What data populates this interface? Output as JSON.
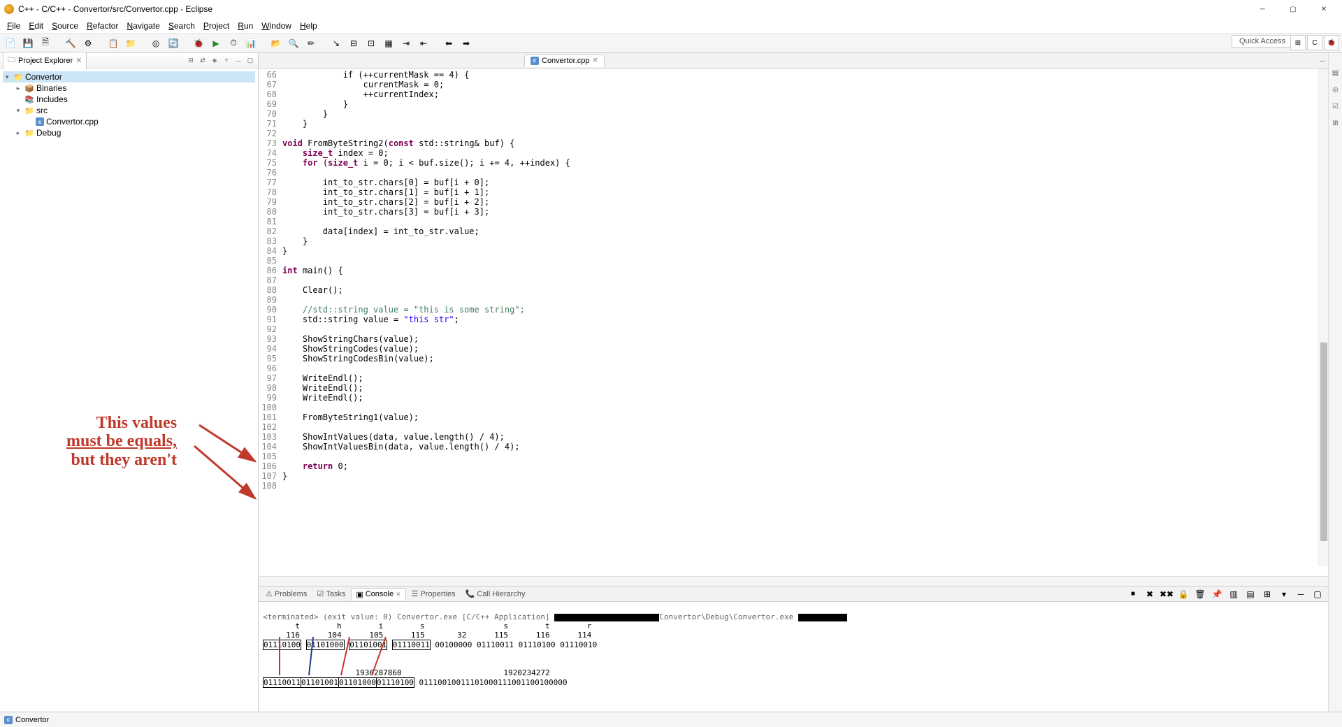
{
  "title": "C++ - C/C++ - Convertor/src/Convertor.cpp - Eclipse",
  "menu": [
    "File",
    "Edit",
    "Source",
    "Refactor",
    "Navigate",
    "Search",
    "Project",
    "Run",
    "Window",
    "Help"
  ],
  "quick_access": "Quick Access",
  "project_explorer": {
    "title": "Project Explorer",
    "root": "Convertor",
    "items": [
      {
        "label": "Binaries",
        "indent": 1,
        "exp": "▸",
        "icon": "📦"
      },
      {
        "label": "Includes",
        "indent": 1,
        "exp": "",
        "icon": "📚"
      },
      {
        "label": "src",
        "indent": 1,
        "exp": "▾",
        "icon": "📁"
      },
      {
        "label": "Convertor.cpp",
        "indent": 2,
        "exp": "",
        "icon": "c"
      },
      {
        "label": "Debug",
        "indent": 1,
        "exp": "▸",
        "icon": "📁"
      }
    ]
  },
  "editor_tab": "Convertor.cpp",
  "code_lines": [
    {
      "n": 66,
      "t": "            if (++currentMask == 4) {"
    },
    {
      "n": 67,
      "t": "                currentMask = 0;"
    },
    {
      "n": 68,
      "t": "                ++currentIndex;"
    },
    {
      "n": 69,
      "t": "            }"
    },
    {
      "n": 70,
      "t": "        }"
    },
    {
      "n": 71,
      "t": "    }"
    },
    {
      "n": 72,
      "t": ""
    },
    {
      "n": 73,
      "t": "void FromByteString2(const std::string& buf) {",
      "hl": "void |const "
    },
    {
      "n": 74,
      "t": "    size_t index = 0;"
    },
    {
      "n": 75,
      "t": "    for (size_t i = 0; i < buf.size(); i += 4, ++index) {",
      "hl": "for "
    },
    {
      "n": 76,
      "t": ""
    },
    {
      "n": 77,
      "t": "        int_to_str.chars[0] = buf[i + 0];"
    },
    {
      "n": 78,
      "t": "        int_to_str.chars[1] = buf[i + 1];"
    },
    {
      "n": 79,
      "t": "        int_to_str.chars[2] = buf[i + 2];"
    },
    {
      "n": 80,
      "t": "        int_to_str.chars[3] = buf[i + 3];"
    },
    {
      "n": 81,
      "t": ""
    },
    {
      "n": 82,
      "t": "        data[index] = int_to_str.value;"
    },
    {
      "n": 83,
      "t": "    }"
    },
    {
      "n": 84,
      "t": "}"
    },
    {
      "n": 85,
      "t": ""
    },
    {
      "n": 86,
      "t": "int main() {",
      "hl": "int "
    },
    {
      "n": 87,
      "t": ""
    },
    {
      "n": 88,
      "t": "    Clear();"
    },
    {
      "n": 89,
      "t": ""
    },
    {
      "n": 90,
      "t": "    //std::string value = \"this is some string\";",
      "cmt": true
    },
    {
      "n": 91,
      "t": "    std::string value = \"this str\";",
      "str": "\"this str\""
    },
    {
      "n": 92,
      "t": ""
    },
    {
      "n": 93,
      "t": "    ShowStringChars(value);"
    },
    {
      "n": 94,
      "t": "    ShowStringCodes(value);"
    },
    {
      "n": 95,
      "t": "    ShowStringCodesBin(value);"
    },
    {
      "n": 96,
      "t": ""
    },
    {
      "n": 97,
      "t": "    WriteEndl();"
    },
    {
      "n": 98,
      "t": "    WriteEndl();"
    },
    {
      "n": 99,
      "t": "    WriteEndl();"
    },
    {
      "n": 100,
      "t": ""
    },
    {
      "n": 101,
      "t": "    FromByteString1(value);"
    },
    {
      "n": 102,
      "t": ""
    },
    {
      "n": 103,
      "t": "    ShowIntValues(data, value.length() / 4);"
    },
    {
      "n": 104,
      "t": "    ShowIntValuesBin(data, value.length() / 4);"
    },
    {
      "n": 105,
      "t": ""
    },
    {
      "n": 106,
      "t": "    return 0;",
      "hl": "return "
    },
    {
      "n": 107,
      "t": "}"
    },
    {
      "n": 108,
      "t": ""
    }
  ],
  "bottom_tabs": [
    "Problems",
    "Tasks",
    "Console",
    "Properties",
    "Call Hierarchy"
  ],
  "bottom_active": 2,
  "console_header": "<terminated> (exit value: 0) Convertor.exe [C/C++ Application] ",
  "console_path_mid": "Convertor\\Debug\\Convertor.exe ",
  "console_lines": {
    "chars": "       t        h        i        s                 s        t        r",
    "codes": "     116      104      105      115       32      115      116      114",
    "bins1": "01110100 01101000 01101001 01110011 00100000 01110011 01110100 01110010",
    "int1": "                    1936287860                      1920234272",
    "bins2": "01110011011010010110100001110100 01110010011101000111001100100000"
  },
  "statusbar": "Convertor",
  "annotation": {
    "l1": "This values",
    "l2": "must be equals,",
    "l3": "but they aren't"
  }
}
